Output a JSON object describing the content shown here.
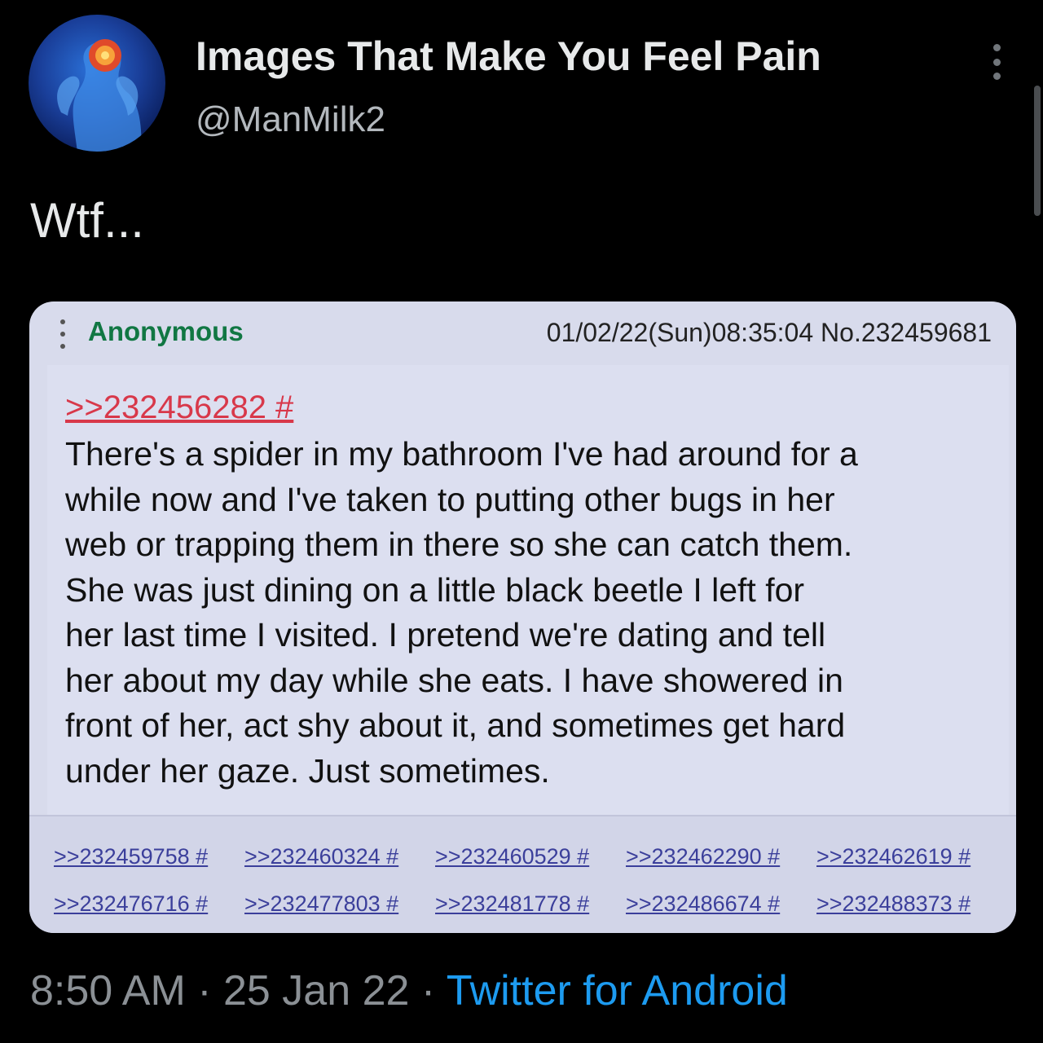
{
  "tweet": {
    "display_name": "Images That Make You Feel Pain",
    "handle": "@ManMilk2",
    "text": "Wtf...",
    "time": "8:50 AM",
    "separator": " · ",
    "date": "25 Jan 22",
    "source": "Twitter for Android"
  },
  "post": {
    "poster": "Anonymous",
    "meta": "01/02/22(Sun)08:35:04 No.232459681",
    "quote": ">>232456282 #",
    "body_lines": [
      "There's a spider in my bathroom I've had around for a",
      "while now and I've taken to putting other bugs in her",
      "web or trapping them in there so she can catch them.",
      "She was just dining on a little black beetle I left for",
      "her last time I visited. I pretend we're dating and tell",
      "her about my day while she eats. I have showered in",
      "front of her, act shy about it, and sometimes get hard",
      "under her gaze. Just sometimes."
    ],
    "replies_row1": [
      ">>232459758 #",
      ">>232460324 #",
      ">>232460529 #",
      ">>232462290 #",
      ">>232462619 #"
    ],
    "replies_row2": [
      ">>232476716 #",
      ">>232477803 #",
      ">>232481778 #",
      ">>232486674 #",
      ">>232488373 #"
    ]
  },
  "colors": {
    "background": "#000000",
    "link_blue": "#1d9bf0",
    "poster_green": "#117743",
    "quote_red": "#d8384a"
  },
  "icons": [
    "avatar-headache-image",
    "more-options-icon",
    "post-menu-icon"
  ]
}
